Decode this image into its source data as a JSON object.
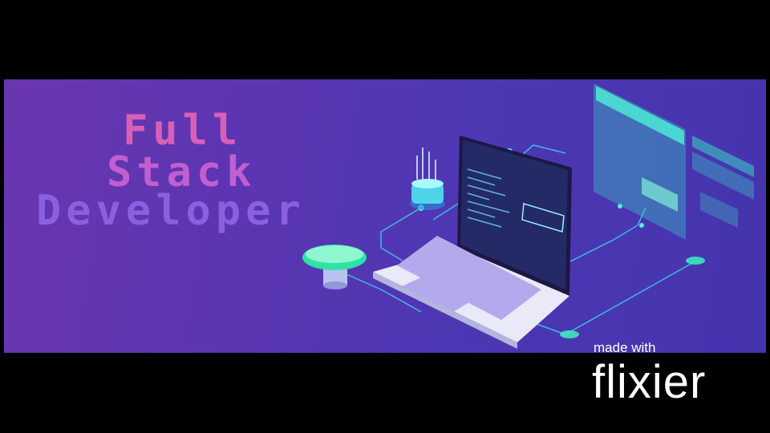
{
  "banner": {
    "title_lines": [
      "Full",
      "Stack",
      "Developer"
    ],
    "colors": {
      "line1": "#d85fb8",
      "line2": "#c15fd0",
      "line3": "#8a5fe0",
      "accent": "#2ee6c8"
    }
  },
  "watermark": {
    "made_with": "made with",
    "brand": "flixier"
  }
}
